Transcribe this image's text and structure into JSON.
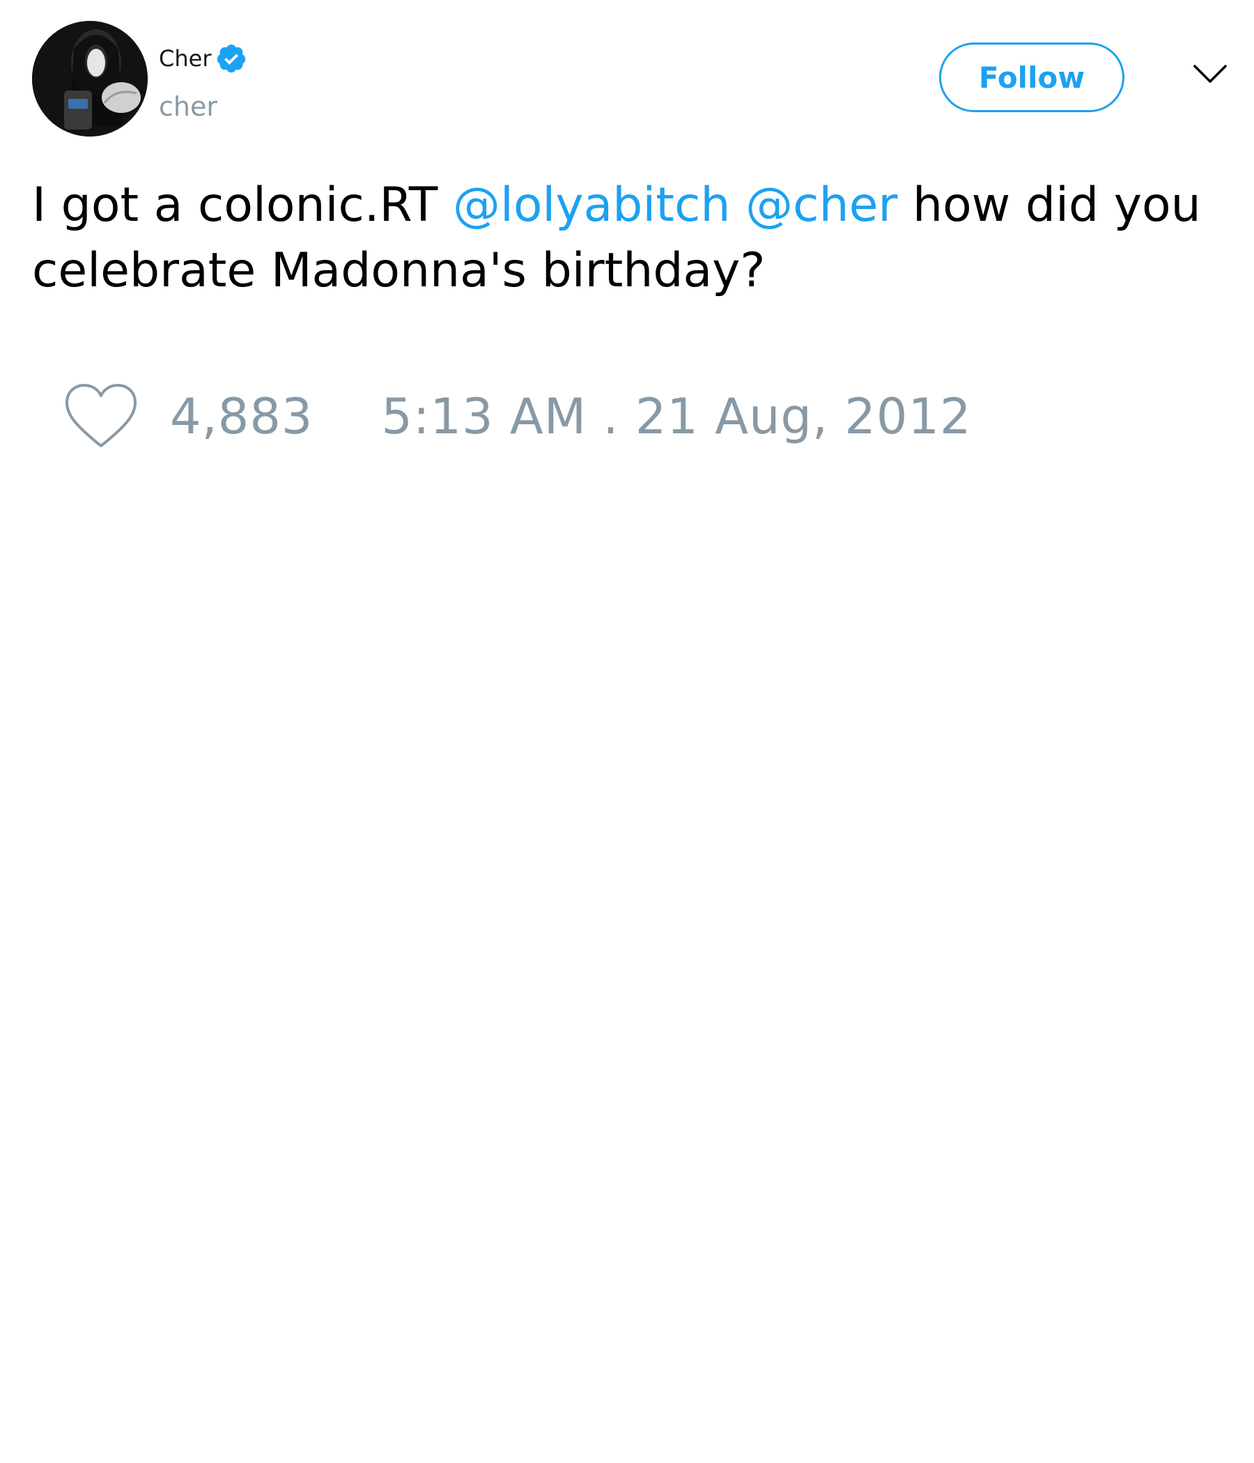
{
  "user": {
    "display_name": "Cher",
    "handle": "cher",
    "verified": true,
    "avatar_icon": "profile-photo"
  },
  "actions": {
    "follow_label": "Follow",
    "menu_icon": "chevron-down-icon"
  },
  "tweet": {
    "text_prefix": "I got a colonic.RT ",
    "mention_1": "@lolyabitch",
    "space": " ",
    "mention_2": "@cher",
    "text_suffix": " how did you celebrate Madonna's birthday?"
  },
  "footer": {
    "like_icon": "heart-icon",
    "like_count": "4,883",
    "timestamp": "5:13 AM . 21 Aug, 2012"
  },
  "colors": {
    "accent": "#1da1f2",
    "muted": "#8899a6",
    "text": "#000000"
  }
}
